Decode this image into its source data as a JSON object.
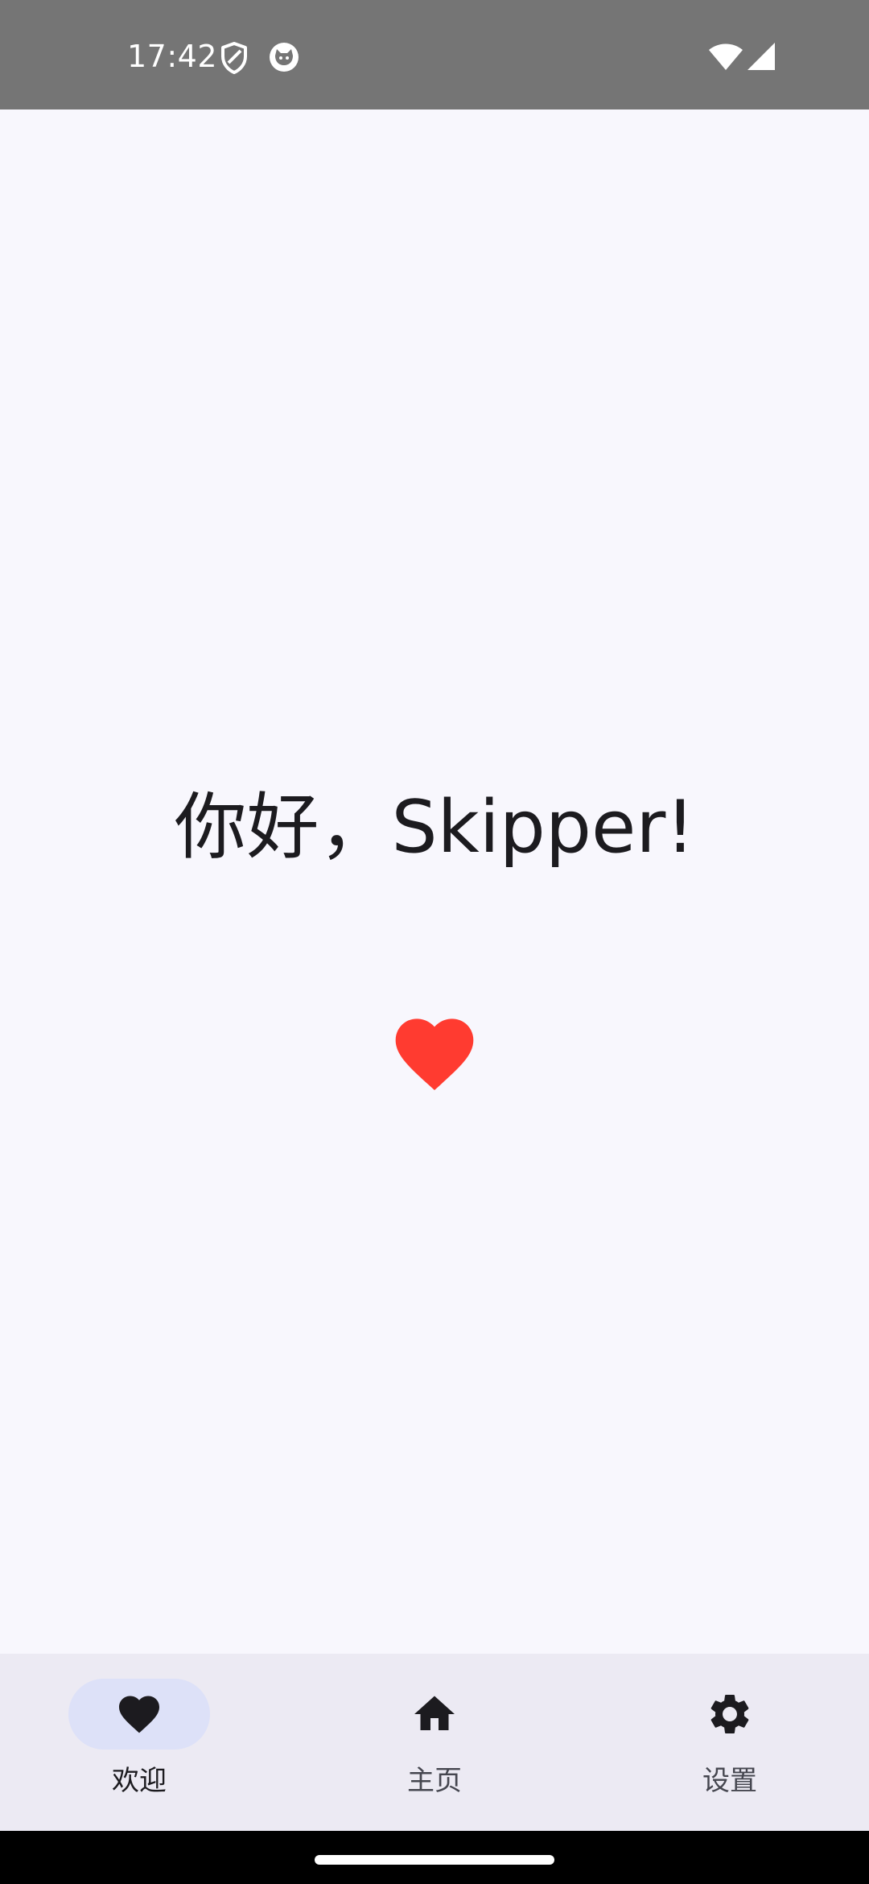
{
  "status_bar": {
    "time": "17:42",
    "icons": [
      "shield-icon",
      "cat-face-icon",
      "wifi-icon",
      "cell-signal-icon"
    ]
  },
  "main": {
    "greeting": "你好，Skipper!",
    "heart_color": "#ff3b30"
  },
  "bottom_nav": {
    "items": [
      {
        "label": "欢迎",
        "icon": "heart-icon",
        "selected": true
      },
      {
        "label": "主页",
        "icon": "home-icon",
        "selected": false
      },
      {
        "label": "设置",
        "icon": "settings-gear-icon",
        "selected": false
      }
    ],
    "active_indicator_color": "#dde1f8"
  }
}
